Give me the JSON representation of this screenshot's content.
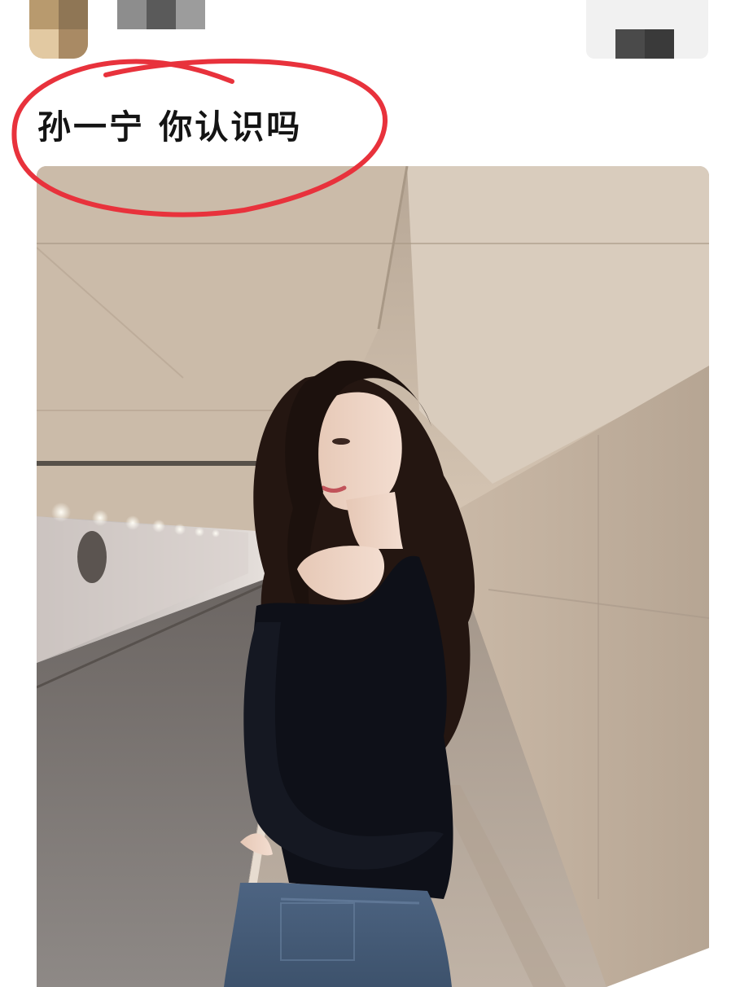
{
  "post": {
    "text": "孙一宁 你认识吗"
  },
  "colors": {
    "annotation_red": "#e8323c",
    "follow_button_bg": "#f1f1f1"
  },
  "icons": {
    "avatar": "user-avatar-blurred",
    "annotation": "red-hand-drawn-circle"
  }
}
